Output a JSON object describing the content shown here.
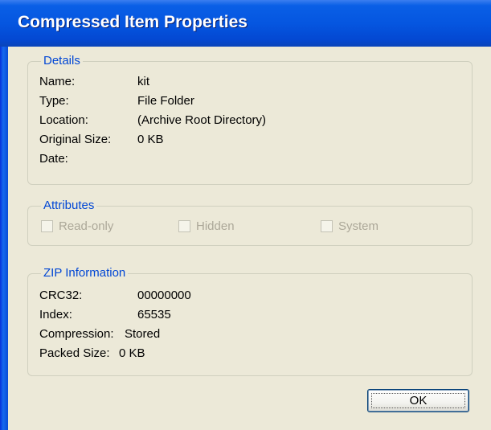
{
  "window": {
    "title": "Compressed Item Properties"
  },
  "details": {
    "title": "Details",
    "name_label": "Name:",
    "name_value": "kit",
    "type_label": "Type:",
    "type_value": "File Folder",
    "location_label": "Location:",
    "location_value": "(Archive Root Directory)",
    "original_size_label": "Original Size:",
    "original_size_value": "0 KB",
    "date_label": "Date:",
    "date_value": ""
  },
  "attributes": {
    "title": "Attributes",
    "readonly_label": "Read-only",
    "hidden_label": "Hidden",
    "system_label": "System"
  },
  "zip": {
    "title": "ZIP Information",
    "crc_label": "CRC32:",
    "crc_value": "00000000",
    "index_label": "Index:",
    "index_value": "65535",
    "compression_label": "Compression:",
    "compression_value": "Stored",
    "packed_size_label": "Packed Size:",
    "packed_size_value": "0 KB"
  },
  "buttons": {
    "ok_label": "OK"
  },
  "colors": {
    "title_bar": "#0556e0",
    "group_title": "#0046d5",
    "dialog_background": "#ece9d8",
    "disabled_text": "#aca899"
  }
}
